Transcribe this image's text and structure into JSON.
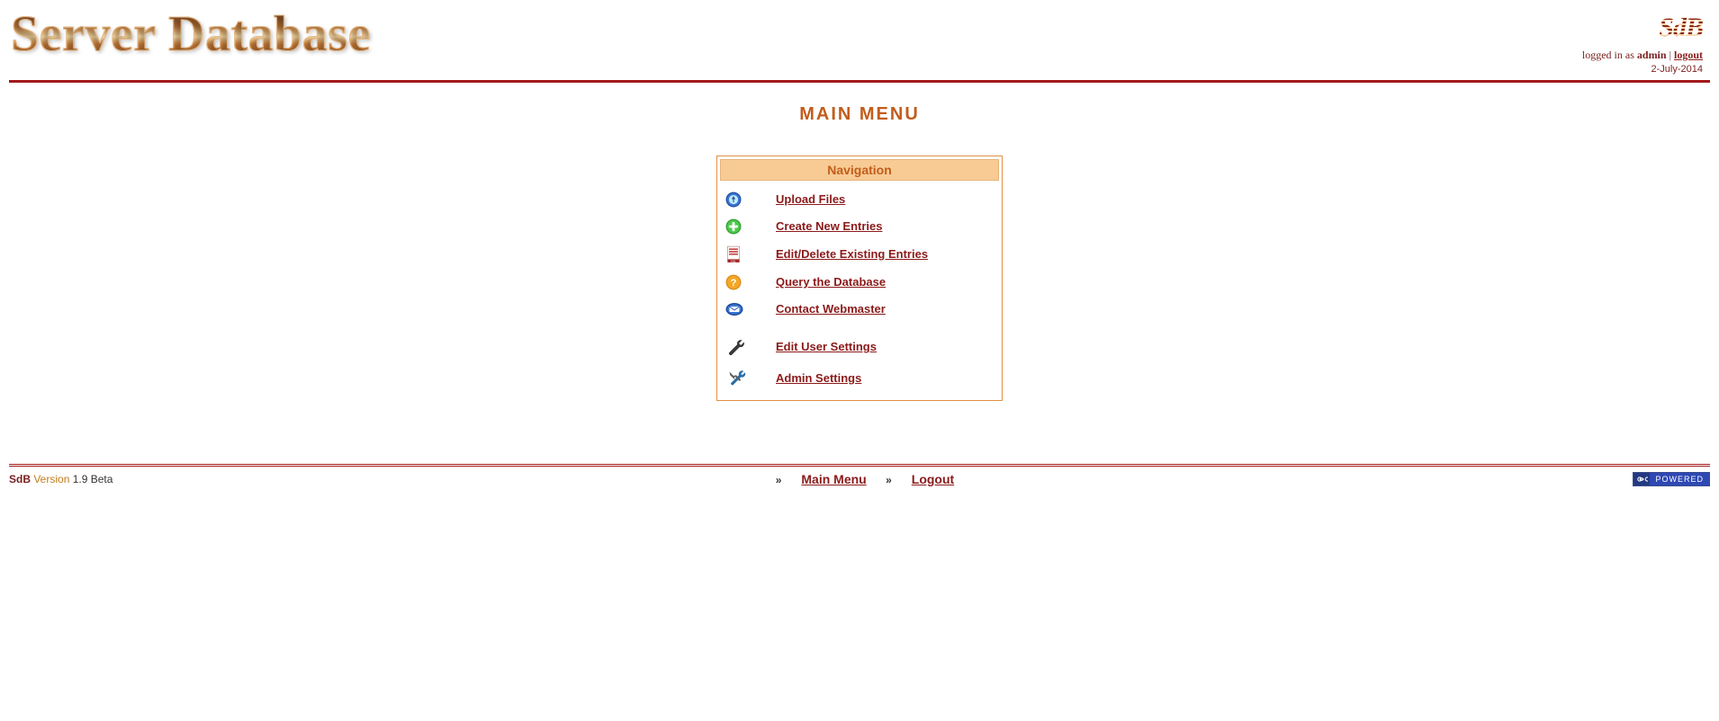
{
  "header": {
    "app_title": "Server Database",
    "mini_logo_text": "SdB",
    "logged_in_prefix": "logged in as ",
    "logged_in_user": "admin",
    "separator": " | ",
    "logout_label": "logout",
    "date_text": "2-July-2014"
  },
  "main": {
    "page_title": "MAIN MENU",
    "nav_header": "Navigation",
    "items": [
      {
        "label": "Upload Files"
      },
      {
        "label": "Create New Entries"
      },
      {
        "label": "Edit/Delete Existing Entries"
      },
      {
        "label": "Query the Database"
      },
      {
        "label": "Contact Webmaster"
      },
      {
        "label": "Edit User Settings"
      },
      {
        "label": "Admin Settings"
      }
    ]
  },
  "footer": {
    "sdb_label": "SdB",
    "version_word": "Version",
    "version_number": "1.9 Beta",
    "main_menu_label": "Main Menu",
    "logout_label": "Logout",
    "bullet": "»",
    "powered_label": "POWERED"
  }
}
